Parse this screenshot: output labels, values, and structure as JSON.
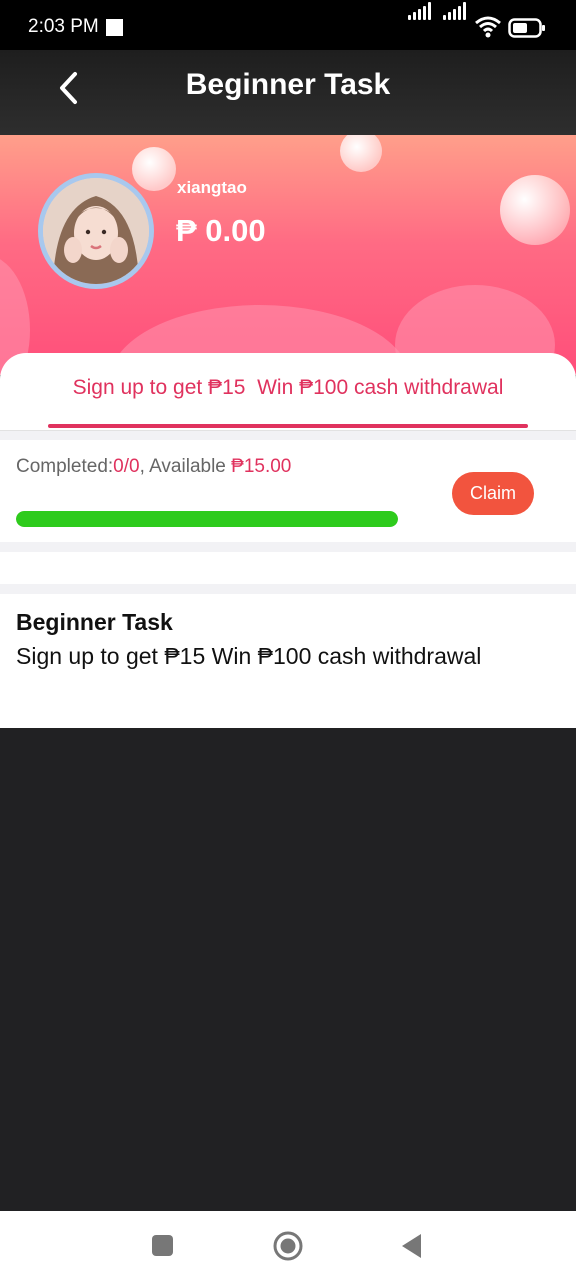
{
  "status_bar": {
    "time": "2:03 PM"
  },
  "header": {
    "title": "Beginner Task"
  },
  "profile": {
    "username": "xiangtao",
    "balance": "₱ 0.00"
  },
  "tab": {
    "label": "Sign up to get ₱15  Win ₱100 cash withdrawal"
  },
  "progress": {
    "completed_label": "Completed:",
    "completed_value": "0/0",
    "available_label": ", Available ",
    "available_value": "₱15.00",
    "fraction": 1.0,
    "claim_label": "Claim"
  },
  "description": {
    "title": "Beginner Task",
    "text": "Sign up to get ₱15 Win ₱100 cash withdrawal"
  },
  "colors": {
    "accent": "#e0325e",
    "progress": "#2ecb1c",
    "claim": "#f2543e"
  },
  "icons": [
    "back-arrow-icon",
    "wifi-icon",
    "battery-icon",
    "signal-icon",
    "nav-recents-icon",
    "nav-home-icon",
    "nav-back-icon"
  ]
}
